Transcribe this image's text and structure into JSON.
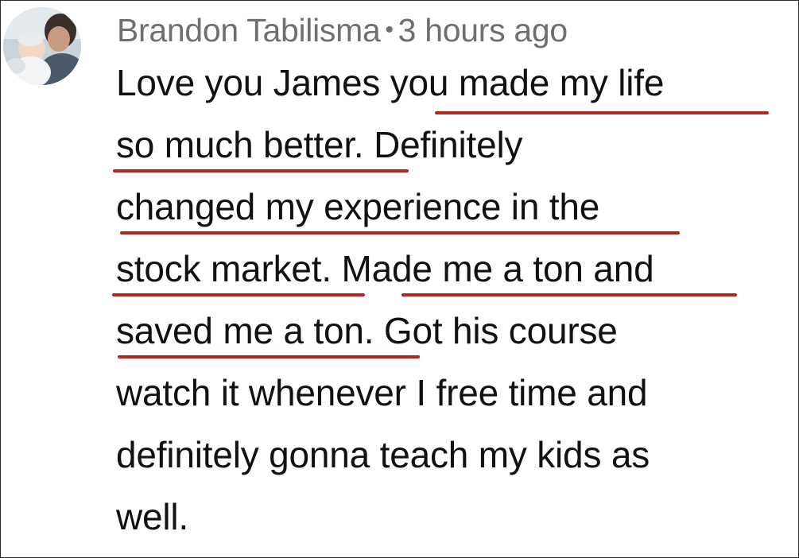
{
  "comment": {
    "author": "Brandon Tabilisma",
    "separator": "•",
    "timestamp": "3 hours ago",
    "avatar_icon": "user-avatar-icon",
    "text_lines": [
      "Love you James you made my life",
      "so much better. Definitely",
      "changed my experience in the",
      "stock market. Made me a ton and",
      "saved me a ton. Got his course",
      "watch it whenever I free time and",
      "definitely gonna teach my kids as",
      "well."
    ],
    "highlighted_phrases": [
      "you made my life",
      "so much better.",
      "changed my experience in the",
      "stock market",
      "Made me a ton and",
      "saved me a ton."
    ],
    "underline_color": "#b3261e"
  }
}
